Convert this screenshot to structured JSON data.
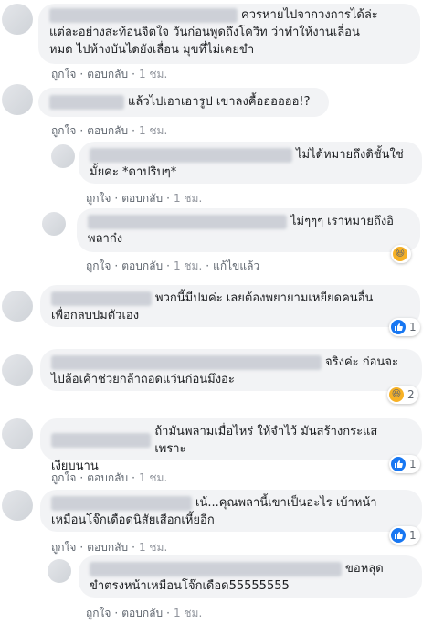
{
  "common": {
    "like": "ถูกใจ",
    "reply": "ตอบกลับ",
    "dot": "·",
    "edited": "แก้ไขแล้ว"
  },
  "comments": [
    {
      "line1": "ควรหายไปจากวงการได้ล่ะ",
      "line2": "แต่ละอย่างสะท้อนจิตใจ วันก่อนพูดถึงโควิท ว่าทำให้งานเลื่อน",
      "line3": "หมด ไปห้างบันไดยังเลื่อน มุขที่ไม่เคยขำ",
      "time": "1 ชม."
    },
    {
      "line1": "แล้วไปเอาเอารูป เขาลงคื้ออออออ!?",
      "time": "1 ชม."
    },
    {
      "line1": "ไม่ได้หมายถึงดิชั้นใช่",
      "line2": "มั้ยคะ *ดาปริบๆ*",
      "time": "1 ชม."
    },
    {
      "line1": "ไม่ๆๆๆ เราหมายถึงอิ",
      "line2": "พลาก๋ง",
      "time": "1 ชม.",
      "reaction": {
        "type": "haha"
      }
    },
    {
      "line1": "พวกนี้มีปมค่ะ เลยต้องพยายามเหยียดคนอื่น",
      "line2": "เพื่อกลบปมตัวเอง",
      "reaction": {
        "type": "like",
        "count": "1"
      }
    },
    {
      "line1": "จริงค่ะ ก่อนจะ",
      "line2": "ไปล้อเค้าช่วยกล้าถอดแว่นก่อนมึงอะ",
      "reaction": {
        "type": "haha",
        "count": "2"
      }
    },
    {
      "line1": "ถ้ามันพลามเมื่อไหร่ ให้จำไว้ มันสร้างกระแส เพราะ",
      "line2": "เงียบนาน",
      "time": "1 ชม.",
      "reaction": {
        "type": "like",
        "count": "1"
      }
    },
    {
      "line1": "เน้...คุณพลานี้เขาเป็นอะไร เบ้าหน้า",
      "line2": "เหมือนโจ๊กเดือดนิสัยเสือกเหี้ยอีก",
      "time": "1 ชม.",
      "reaction": {
        "type": "like",
        "count": "1"
      }
    },
    {
      "line1": "ขอหลุด",
      "line2": "ขำตรงหน้าเหมือนโจ๊กเดือด55555555",
      "time": "1 ชม."
    }
  ],
  "colors": {
    "like_blue": "#1877f2",
    "haha_yellow": "#f7b125"
  }
}
